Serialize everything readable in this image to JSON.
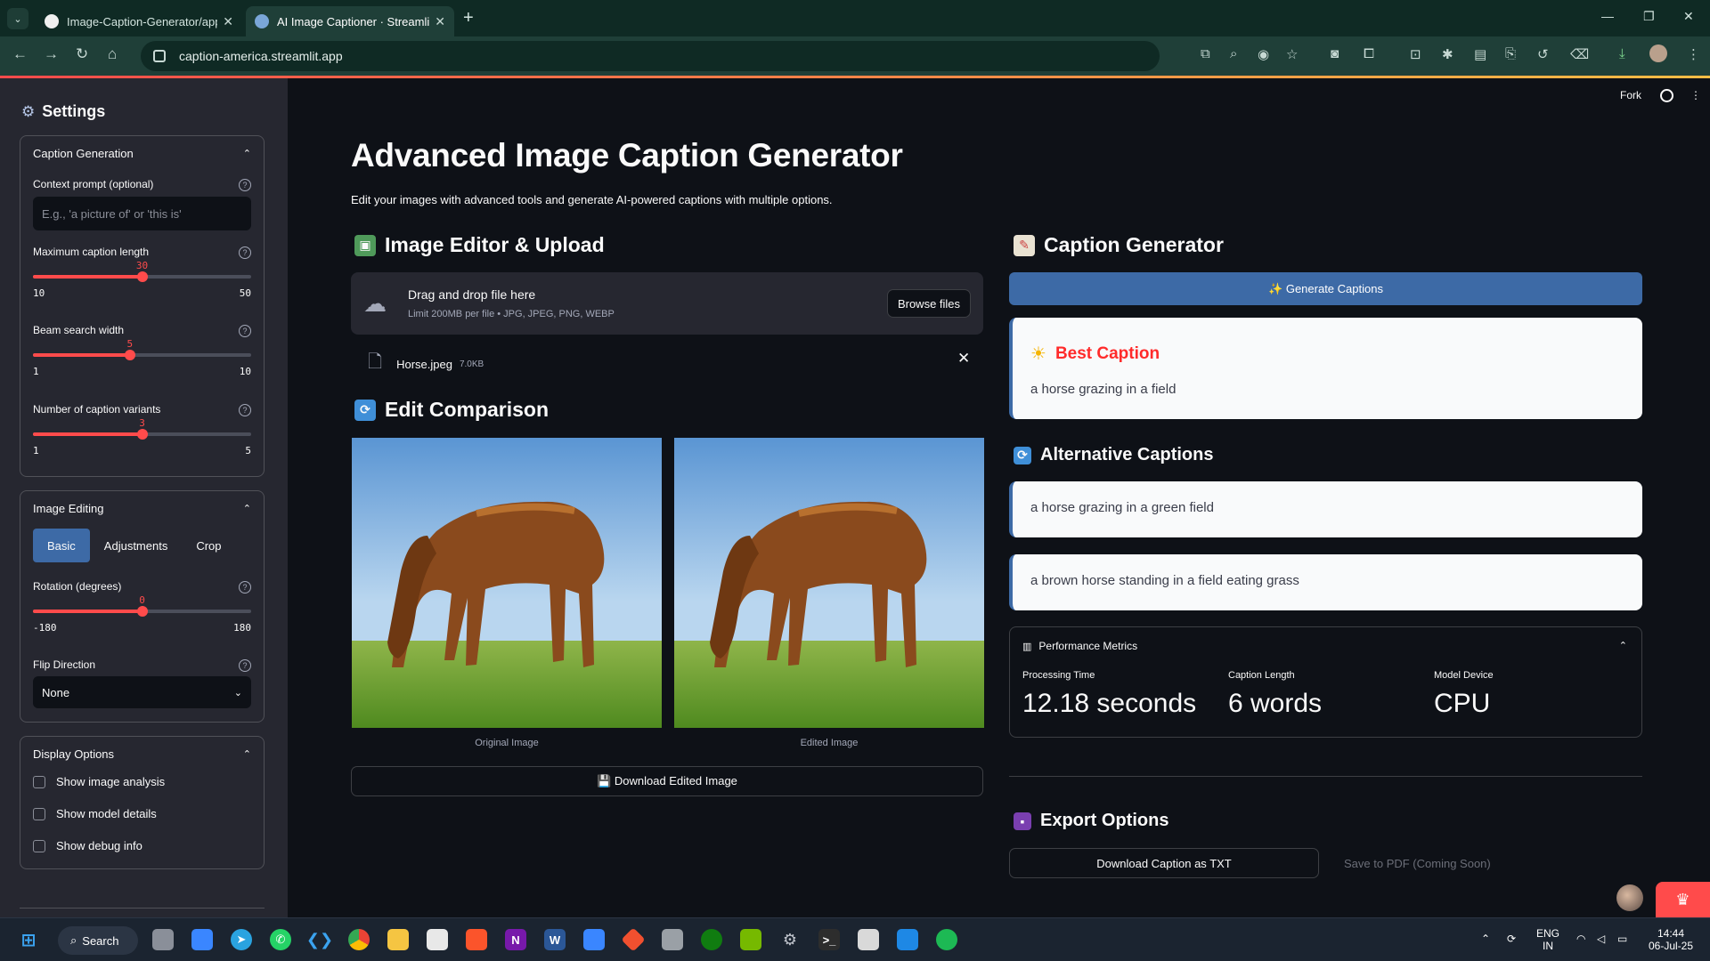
{
  "browser": {
    "tabs": [
      {
        "label": "Image-Caption-Generator/app",
        "close": "✕"
      },
      {
        "label": "AI Image Captioner · Streamlit",
        "close": "✕"
      }
    ],
    "new_tab": "+",
    "url": "caption-america.streamlit.app"
  },
  "sidebar": {
    "title": "Settings",
    "caption_generation": {
      "header": "Caption Generation",
      "context_label": "Context prompt (optional)",
      "context_placeholder": "E.g., 'a picture of' or 'this is'",
      "max_len": {
        "label": "Maximum caption length",
        "value": "30",
        "min": "10",
        "max": "50",
        "fraction": 0.5
      },
      "beam": {
        "label": "Beam search width",
        "value": "5",
        "min": "1",
        "max": "10",
        "fraction": 0.444
      },
      "variants": {
        "label": "Number of caption variants",
        "value": "3",
        "min": "1",
        "max": "5",
        "fraction": 0.5
      }
    },
    "image_editing": {
      "header": "Image Editing",
      "tabs": [
        "Basic",
        "Adjustments",
        "Crop"
      ],
      "rotation": {
        "label": "Rotation (degrees)",
        "value": "0",
        "min": "-180",
        "max": "180",
        "fraction": 0.5
      },
      "flip_label": "Flip Direction",
      "flip_value": "None"
    },
    "display_options": {
      "header": "Display Options",
      "checks": [
        "Show image analysis",
        "Show model details",
        "Show debug info"
      ]
    }
  },
  "main": {
    "fork": "Fork",
    "title": "Advanced Image Caption Generator",
    "subtitle": "Edit your images with advanced tools and generate AI-powered captions with multiple options.",
    "editor_header": "Image Editor & Upload",
    "uploader": {
      "drag": "Drag and drop file here",
      "limit": "Limit 200MB per file • JPG, JPEG, PNG, WEBP",
      "browse": "Browse files"
    },
    "file": {
      "name": "Horse.jpeg",
      "size": "7.0KB"
    },
    "comparison_header": "Edit Comparison",
    "original_label": "Original Image",
    "edited_label": "Edited Image",
    "download_edited": "💾  Download Edited Image",
    "caption_header": "Caption Generator",
    "generate": "✨ Generate Captions",
    "best_title": "Best Caption",
    "best_caption": "a horse grazing in a field",
    "alt_header": "Alternative Captions",
    "alternatives": [
      "a horse grazing in a green field",
      "a brown horse standing in a field eating grass"
    ],
    "metrics": {
      "header": "Performance Metrics",
      "items": [
        {
          "label": "Processing Time",
          "value": "12.18 seconds"
        },
        {
          "label": "Caption Length",
          "value": "6 words"
        },
        {
          "label": "Model Device",
          "value": "CPU"
        }
      ]
    },
    "export_header": "Export Options",
    "download_txt": "Download Caption as TXT",
    "save_pdf": "Save to PDF (Coming Soon)"
  },
  "taskbar": {
    "search": "Search",
    "lang_top": "ENG",
    "lang_bottom": "IN",
    "time": "14:44",
    "date": "06-Jul-25"
  },
  "colors": {
    "accent_red": "#ff4b4b",
    "button_blue": "#3d6aa6",
    "best_caption_red": "#ff2b2b",
    "sidebar_bg": "#262730",
    "main_bg": "#0e1117"
  }
}
